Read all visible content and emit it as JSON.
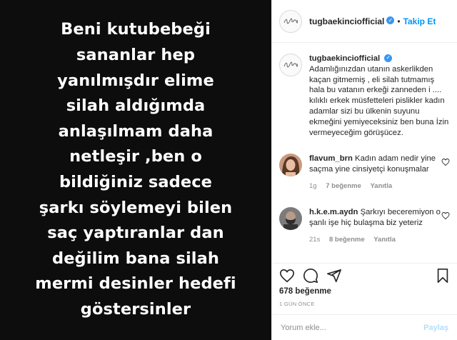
{
  "post_image": {
    "lines": [
      "Beni kutubebeği",
      "sananlar hep",
      "yanılmışdır elime",
      "silah aldığımda",
      "anlaşılmam daha",
      "netleşir ,ben o",
      "bildiğiniz sadece",
      "şarkı söylemeyi bilen",
      "saç yaptıranlar dan",
      "değilim bana silah",
      "mermi desinler hedefi",
      "göstersinler"
    ]
  },
  "header": {
    "username": "tugbaekinciofficial",
    "separator": "•",
    "follow_label": "Takip Et",
    "verified_icon": "verified-badge-icon"
  },
  "caption": {
    "username": "tugbaekinciofficial",
    "text": "Adamlığınızdan utanın askerlikden kaçan gitmemiş , eli silah tutmamış hala bu vatanın erkeği zanneden i .... kılıklı erkek müsfetteleri pislikler kadın adamlar sizi bu ülkenin suyunu ekmeğini yemiyeceksiniz ben buna İzin vermeyeceğim görüşücez."
  },
  "comments": [
    {
      "username": "flavum_brn",
      "text": "Kadın adam nedir yine saçma yine cinsiyetçi konuşmalar",
      "time": "1g",
      "likes": "7 beğenme",
      "reply": "Yanıtla"
    },
    {
      "username": "h.k.e.m.aydn",
      "text": "Şarkıyı beceremiyon o şanlı işe hiç bulaşma biz yeteriz",
      "time": "21s",
      "likes": "8 beğenme",
      "reply": "Yanıtla"
    }
  ],
  "likes_count": "678 beğenme",
  "timestamp": "1 GÜN ÖNCE",
  "add_comment": {
    "placeholder": "Yorum ekle...",
    "post_label": "Paylaş"
  },
  "colors": {
    "accent": "#0095f6",
    "post_bg": "#0d0d0d",
    "muted": "#8e8e8e"
  }
}
